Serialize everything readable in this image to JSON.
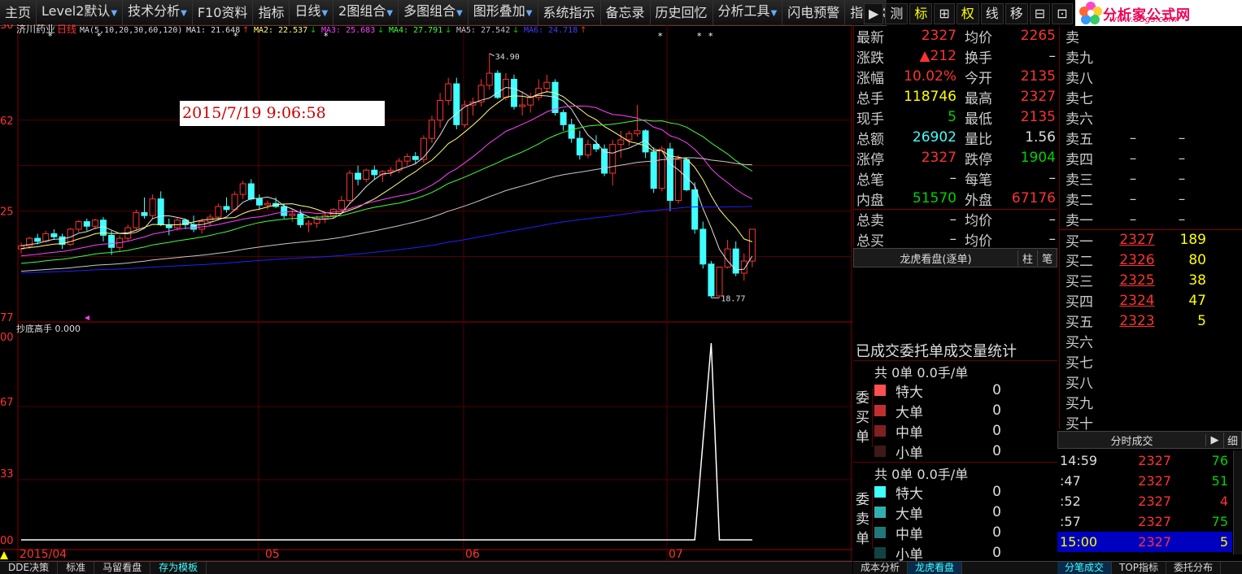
{
  "menubar": {
    "items": [
      {
        "label": "主页",
        "arrow": false
      },
      {
        "label": "Level2默认",
        "arrow": true
      },
      {
        "label": "技术分析",
        "arrow": true
      },
      {
        "label": "F10资料",
        "arrow": false
      },
      {
        "label": "指标",
        "arrow": false
      },
      {
        "label": "日线",
        "arrow": true
      },
      {
        "label": "2图组合",
        "arrow": true
      },
      {
        "label": "多图组合",
        "arrow": true
      },
      {
        "label": "图形叠加",
        "arrow": true
      },
      {
        "label": "系统指示",
        "arrow": false
      },
      {
        "label": "备忘录",
        "arrow": false
      },
      {
        "label": "历史回忆",
        "arrow": false
      },
      {
        "label": "分析工具",
        "arrow": true
      },
      {
        "label": "闪电预警",
        "arrow": false
      },
      {
        "label": "指标类型",
        "arrow": false
      }
    ],
    "tools": [
      {
        "label": "▶",
        "active": false
      },
      {
        "label": "测",
        "active": false
      },
      {
        "label": "标",
        "active": true
      },
      {
        "label": "⊞",
        "active": false
      },
      {
        "label": "权",
        "active": true
      },
      {
        "label": "线",
        "active": false
      },
      {
        "label": "移",
        "active": false
      },
      {
        "label": "⊟",
        "active": false
      },
      {
        "label": "⊡",
        "active": false
      }
    ]
  },
  "logo": {
    "title": "分析家公式网",
    "url": "www.88gs.com"
  },
  "chart": {
    "stock_name": "济川药业",
    "period": "日线",
    "ma_params": "MA(5,10,20,30,60,120)",
    "ma_values": [
      {
        "label": "MA1: 21.648",
        "color": "#e0e0e0",
        "arrow": "↑",
        "arrow_color": "#ff3232"
      },
      {
        "label": "MA2: 22.537",
        "color": "#ffff80",
        "arrow": "↓",
        "arrow_color": "#00d200"
      },
      {
        "label": "MA3: 25.683",
        "color": "#ff40ff",
        "arrow": "↓",
        "arrow_color": "#00d200"
      },
      {
        "label": "MA4: 27.791",
        "color": "#40ff40",
        "arrow": "↓",
        "arrow_color": "#00d200"
      },
      {
        "label": "MA5: 27.542",
        "color": "#c0c0c0",
        "arrow": "↓",
        "arrow_color": "#00d200"
      },
      {
        "label": "MA6: 24.718",
        "color": "#4040ff",
        "arrow": "↑",
        "arrow_color": "#ff3232"
      }
    ],
    "high_label": "34.90",
    "low_label": "18.77",
    "y_labels": [
      "30",
      "62",
      "25",
      "77"
    ],
    "indicator_name": "抄底高手 0.000",
    "ind_y_labels": [
      "00",
      "67",
      "33",
      "00"
    ],
    "x_labels": [
      "2015/04",
      "05",
      "06",
      "07"
    ],
    "timestamp": "2015/7/19 9:06:58"
  },
  "chart_data": {
    "type": "candlestick",
    "title": "济川药业",
    "xlabel": "",
    "ylabel": "",
    "x_ticks": [
      "2015/04",
      "05",
      "06",
      "07"
    ],
    "high": 34.9,
    "low": 18.77,
    "candles": [
      [
        22.0,
        22.4,
        21.7,
        22.2
      ],
      [
        22.2,
        22.8,
        22.0,
        22.7
      ],
      [
        22.7,
        23.0,
        22.3,
        22.5
      ],
      [
        22.5,
        23.2,
        22.4,
        23.0
      ],
      [
        23.0,
        23.3,
        22.6,
        22.8
      ],
      [
        22.8,
        23.0,
        22.0,
        22.3
      ],
      [
        22.3,
        23.4,
        22.2,
        23.3
      ],
      [
        23.3,
        23.9,
        23.1,
        23.8
      ],
      [
        23.8,
        24.0,
        23.2,
        23.5
      ],
      [
        23.5,
        24.0,
        23.3,
        23.9
      ],
      [
        23.9,
        24.1,
        22.5,
        22.9
      ],
      [
        22.9,
        23.2,
        21.6,
        22.1
      ],
      [
        22.1,
        22.9,
        21.8,
        22.7
      ],
      [
        22.7,
        23.6,
        22.5,
        23.4
      ],
      [
        23.4,
        24.6,
        23.2,
        24.4
      ],
      [
        24.4,
        25.4,
        24.0,
        24.2
      ],
      [
        24.2,
        25.6,
        24.0,
        25.3
      ],
      [
        25.3,
        25.8,
        23.5,
        23.6
      ],
      [
        23.6,
        24.0,
        22.9,
        23.4
      ],
      [
        23.4,
        24.1,
        23.2,
        23.9
      ],
      [
        23.9,
        24.0,
        23.3,
        23.6
      ],
      [
        23.6,
        24.2,
        23.1,
        23.3
      ],
      [
        23.3,
        24.0,
        23.0,
        23.8
      ],
      [
        23.8,
        24.3,
        23.5,
        24.1
      ],
      [
        24.1,
        25.0,
        23.9,
        24.8
      ],
      [
        24.8,
        25.4,
        24.4,
        24.6
      ],
      [
        24.6,
        25.8,
        24.5,
        25.6
      ],
      [
        25.6,
        26.5,
        25.3,
        26.3
      ],
      [
        26.3,
        26.6,
        25.2,
        25.3
      ],
      [
        25.3,
        25.6,
        24.6,
        24.9
      ],
      [
        24.9,
        25.2,
        24.6,
        25.0
      ],
      [
        25.0,
        25.4,
        24.7,
        24.8
      ],
      [
        24.8,
        25.0,
        24.0,
        24.2
      ],
      [
        24.2,
        24.6,
        23.8,
        24.3
      ],
      [
        24.3,
        24.6,
        23.4,
        23.6
      ],
      [
        23.6,
        23.9,
        23.1,
        23.7
      ],
      [
        23.7,
        24.2,
        23.4,
        24.0
      ],
      [
        24.0,
        24.4,
        23.7,
        24.2
      ],
      [
        24.2,
        24.7,
        24.0,
        24.6
      ],
      [
        24.6,
        25.5,
        24.4,
        25.2
      ],
      [
        25.2,
        27.2,
        25.0,
        27.0
      ],
      [
        27.0,
        27.5,
        26.2,
        26.6
      ],
      [
        26.6,
        27.3,
        26.4,
        27.2
      ],
      [
        27.2,
        27.5,
        26.6,
        26.9
      ],
      [
        26.9,
        27.2,
        26.4,
        27.1
      ],
      [
        27.1,
        27.4,
        26.8,
        27.2
      ],
      [
        27.2,
        28.0,
        27.0,
        27.8
      ],
      [
        27.8,
        28.3,
        27.5,
        28.1
      ],
      [
        28.1,
        28.4,
        27.6,
        27.9
      ],
      [
        27.9,
        29.5,
        27.7,
        29.3
      ],
      [
        29.3,
        30.8,
        29.0,
        30.5
      ],
      [
        30.5,
        32.3,
        30.0,
        31.8
      ],
      [
        31.8,
        33.3,
        31.5,
        32.9
      ],
      [
        32.9,
        33.3,
        29.9,
        30.2
      ],
      [
        30.2,
        31.8,
        30.0,
        31.5
      ],
      [
        31.5,
        32.0,
        30.8,
        31.7
      ],
      [
        31.7,
        33.2,
        31.4,
        32.8
      ],
      [
        32.8,
        34.9,
        32.5,
        33.6
      ],
      [
        33.6,
        33.8,
        31.9,
        32.0
      ],
      [
        32.0,
        33.6,
        31.8,
        33.2
      ],
      [
        33.2,
        33.5,
        31.2,
        31.4
      ],
      [
        31.4,
        32.4,
        30.8,
        31.5
      ],
      [
        31.5,
        32.3,
        31.0,
        32.0
      ],
      [
        32.0,
        33.2,
        31.8,
        32.6
      ],
      [
        32.6,
        33.5,
        32.3,
        33.0
      ],
      [
        33.0,
        33.2,
        30.8,
        31.0
      ],
      [
        31.0,
        31.2,
        29.8,
        30.2
      ],
      [
        30.2,
        30.6,
        29.0,
        29.3
      ],
      [
        29.3,
        29.8,
        27.9,
        28.2
      ],
      [
        28.2,
        29.2,
        28.0,
        28.9
      ],
      [
        28.9,
        29.5,
        28.4,
        28.6
      ],
      [
        28.6,
        28.9,
        26.8,
        27.0
      ],
      [
        27.0,
        29.2,
        26.2,
        28.9
      ],
      [
        28.9,
        29.8,
        28.0,
        29.2
      ],
      [
        29.2,
        29.8,
        28.8,
        29.6
      ],
      [
        29.6,
        31.5,
        29.4,
        29.8
      ],
      [
        29.8,
        29.9,
        28.0,
        28.4
      ],
      [
        28.4,
        28.7,
        25.7,
        26.0
      ],
      [
        26.0,
        28.8,
        25.8,
        28.6
      ],
      [
        28.6,
        29.0,
        24.5,
        25.2
      ],
      [
        25.2,
        28.2,
        25.0,
        27.9
      ],
      [
        27.9,
        28.0,
        25.8,
        25.9
      ],
      [
        25.9,
        26.4,
        23.0,
        23.3
      ],
      [
        23.3,
        23.8,
        20.7,
        21.0
      ],
      [
        21.0,
        21.2,
        18.77,
        18.9
      ],
      [
        18.9,
        20.8,
        18.8,
        20.8
      ],
      [
        20.8,
        22.6,
        20.7,
        22.0
      ],
      [
        22.0,
        22.5,
        20.2,
        20.4
      ],
      [
        20.4,
        21.7,
        19.9,
        21.2
      ],
      [
        21.2,
        23.3,
        20.8,
        23.3
      ]
    ],
    "indicator": {
      "name": "抄底高手",
      "spike_index": 84,
      "range": [
        0,
        1
      ]
    }
  },
  "quote": {
    "rows": [
      {
        "l1": "最新",
        "v1": "2327",
        "c1": "red",
        "l2": "均价",
        "v2": "2265",
        "c2": "red"
      },
      {
        "l1": "涨跌",
        "v1": "▲212",
        "c1": "red",
        "l2": "换手",
        "v2": "–",
        "c2": "white"
      },
      {
        "l1": "涨幅",
        "v1": "10.02%",
        "c1": "red",
        "l2": "今开",
        "v2": "2135",
        "c2": "red"
      },
      {
        "l1": "总手",
        "v1": "118746",
        "c1": "yellow",
        "l2": "最高",
        "v2": "2327",
        "c2": "red"
      },
      {
        "l1": "现手",
        "v1": "5",
        "c1": "green",
        "l2": "最低",
        "v2": "2135",
        "c2": "red"
      },
      {
        "l1": "总额",
        "v1": "26902",
        "c1": "cyan",
        "l2": "量比",
        "v2": "1.56",
        "c2": "white"
      },
      {
        "l1": "涨停",
        "v1": "2327",
        "c1": "red",
        "l2": "跌停",
        "v2": "1904",
        "c2": "green"
      },
      {
        "l1": "总笔",
        "v1": "–",
        "c1": "white",
        "l2": "每笔",
        "v2": "–",
        "c2": "white"
      },
      {
        "l1": "内盘",
        "v1": "51570",
        "c1": "green",
        "l2": "外盘",
        "v2": "67176",
        "c2": "red"
      },
      {
        "l1": "总卖",
        "v1": "–",
        "c1": "white",
        "l2": "均价",
        "v2": "–",
        "c2": "white"
      },
      {
        "l1": "总买",
        "v1": "–",
        "c1": "white",
        "l2": "均价",
        "v2": "–",
        "c2": "white"
      }
    ]
  },
  "dragon": {
    "title": "龙虎看盘(逐单)",
    "btn1": "柱",
    "btn2": "笔"
  },
  "stats": {
    "title": "已成交委托单成交量统计",
    "buy": {
      "header": "共 0单 0.0手/单",
      "side": [
        "委",
        "买",
        "单"
      ],
      "rows": [
        {
          "name": "特大",
          "value": "0",
          "color": "#ff5050"
        },
        {
          "name": "大单",
          "value": "0",
          "color": "#c03030"
        },
        {
          "name": "中单",
          "value": "0",
          "color": "#802020"
        },
        {
          "name": "小单",
          "value": "0",
          "color": "#401818"
        }
      ]
    },
    "sell": {
      "header": "共 0单 0.0手/单",
      "side": [
        "委",
        "卖",
        "单"
      ],
      "rows": [
        {
          "name": "特大",
          "value": "0",
          "color": "#40ffff"
        },
        {
          "name": "大单",
          "value": "0",
          "color": "#30b0b0"
        },
        {
          "name": "中单",
          "value": "0",
          "color": "#207878"
        },
        {
          "name": "小单",
          "value": "0",
          "color": "#104444"
        }
      ]
    }
  },
  "book": {
    "rows": [
      {
        "label": "卖",
        "price": "",
        "vol": "",
        "dash": false
      },
      {
        "label": "卖九",
        "price": "",
        "vol": "",
        "dash": false
      },
      {
        "label": "卖八",
        "price": "",
        "vol": "",
        "dash": false
      },
      {
        "label": "卖七",
        "price": "",
        "vol": "",
        "dash": false
      },
      {
        "label": "卖六",
        "price": "",
        "vol": "",
        "dash": false
      },
      {
        "label": "卖五",
        "price": "–",
        "vol": "–",
        "dash": true
      },
      {
        "label": "卖四",
        "price": "–",
        "vol": "–",
        "dash": true
      },
      {
        "label": "卖三",
        "price": "–",
        "vol": "–",
        "dash": true
      },
      {
        "label": "卖二",
        "price": "–",
        "vol": "–",
        "dash": true
      },
      {
        "label": "卖一",
        "price": "–",
        "vol": "–",
        "dash": true
      },
      {
        "label": "买一",
        "price": "2327",
        "vol": "189",
        "dash": false
      },
      {
        "label": "买二",
        "price": "2326",
        "vol": "80",
        "dash": false
      },
      {
        "label": "买三",
        "price": "2325",
        "vol": "38",
        "dash": false
      },
      {
        "label": "买四",
        "price": "2324",
        "vol": "47",
        "dash": false
      },
      {
        "label": "买五",
        "price": "2323",
        "vol": "5",
        "dash": false
      },
      {
        "label": "买六",
        "price": "",
        "vol": "",
        "dash": false
      },
      {
        "label": "买七",
        "price": "",
        "vol": "",
        "dash": false
      },
      {
        "label": "买八",
        "price": "",
        "vol": "",
        "dash": false
      },
      {
        "label": "买九",
        "price": "",
        "vol": "",
        "dash": false
      },
      {
        "label": "买十",
        "price": "",
        "vol": "",
        "dash": false
      }
    ]
  },
  "ticks": {
    "title": "分时成交",
    "btn1": "▶",
    "btn2": "细",
    "rows": [
      {
        "time": "14:59",
        "price": "2327",
        "vol": "76",
        "vc": "green",
        "hl": false
      },
      {
        "time": ":47",
        "price": "2327",
        "vol": "51",
        "vc": "green",
        "hl": false
      },
      {
        "time": ":52",
        "price": "2327",
        "vol": "4",
        "vc": "red",
        "hl": false
      },
      {
        "time": ":57",
        "price": "2327",
        "vol": "75",
        "vc": "green",
        "hl": false
      },
      {
        "time": "15:00",
        "price": "2327",
        "vol": "5",
        "vc": "yellow",
        "hl": true
      }
    ]
  },
  "bottom": {
    "tabs": [
      {
        "label": "DDE决策",
        "active": false
      },
      {
        "label": "标准",
        "active": false
      },
      {
        "label": "马留看盘",
        "active": false
      },
      {
        "label": "存为模板",
        "active": true
      }
    ],
    "right1": [
      {
        "label": "成本分析",
        "active": false
      },
      {
        "label": "龙虎看盘",
        "active": true
      }
    ],
    "right2": [
      {
        "label": "分笔成交",
        "active": true
      },
      {
        "label": "TOP指标",
        "active": false
      },
      {
        "label": "委托分布",
        "active": false
      }
    ]
  }
}
